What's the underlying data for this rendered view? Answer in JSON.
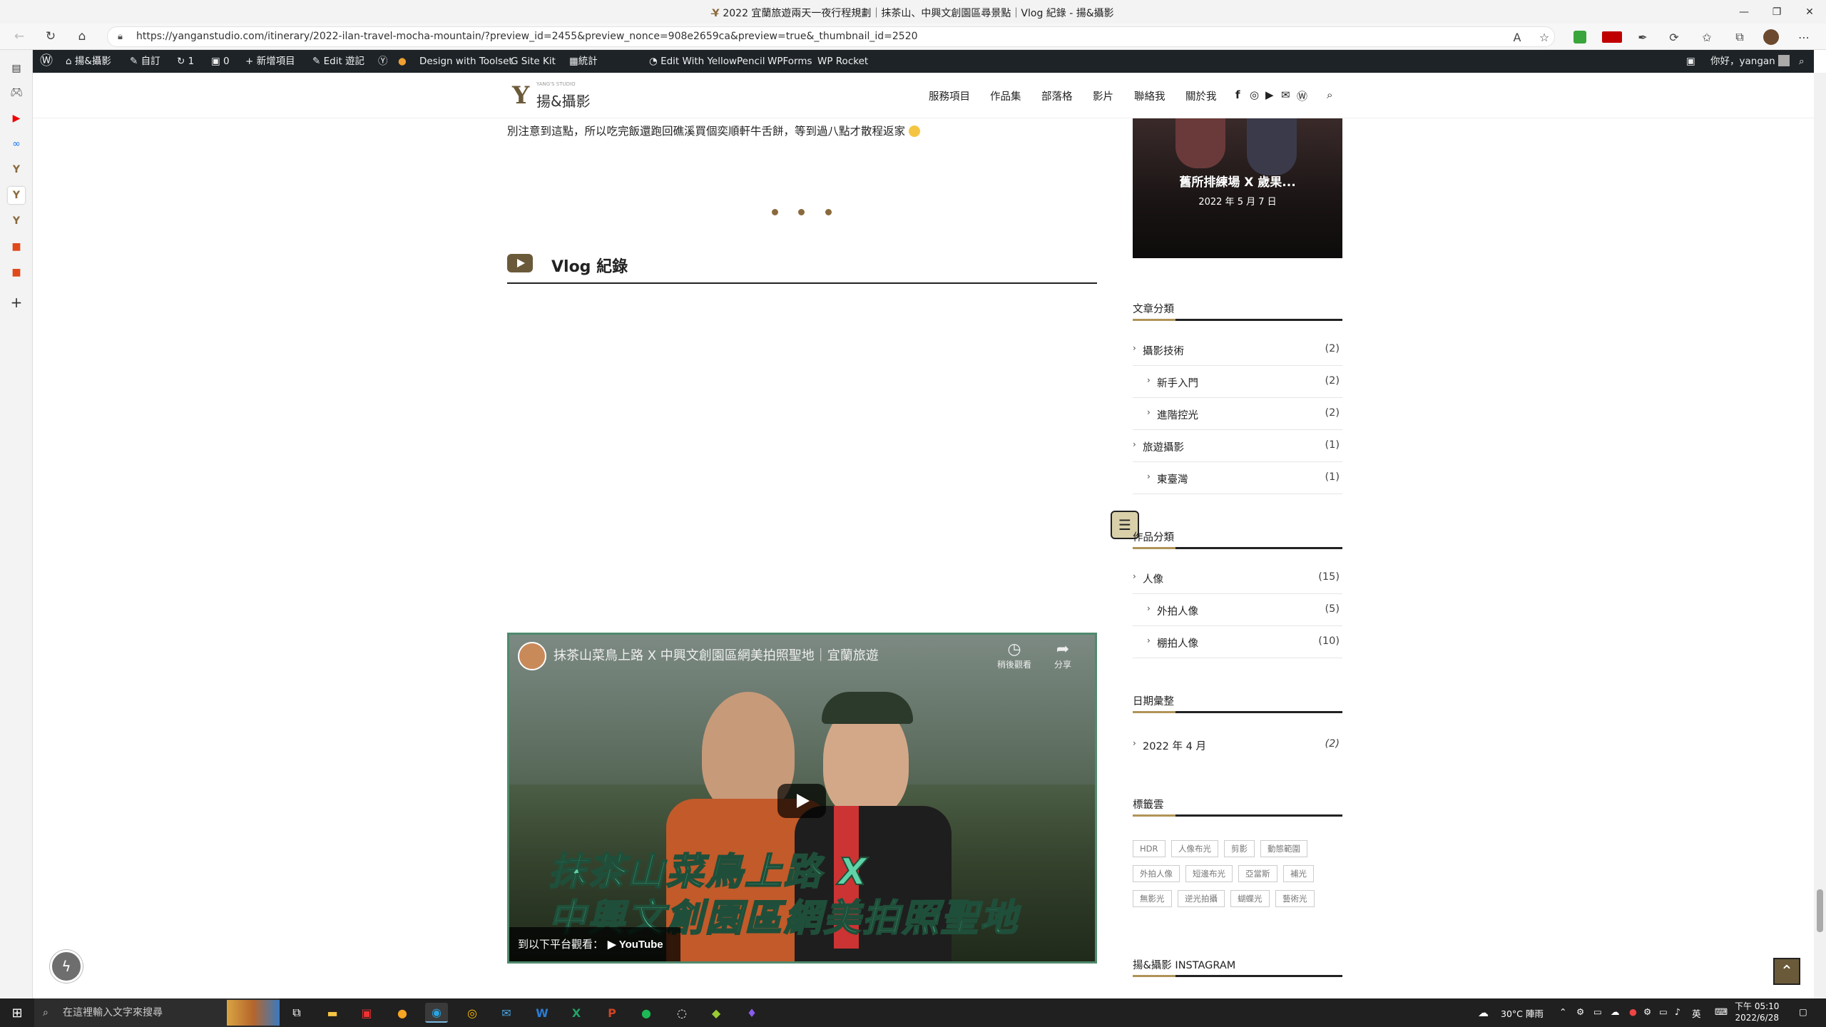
{
  "browser": {
    "tab_title": "2022 宜蘭旅遊兩天一夜行程規劃｜抹茶山、中興文創園區尋景點｜Vlog 紀錄 - 揚&攝影",
    "url": "https://yanganstudio.com/itinerary/2022-ilan-travel-mocha-mountain/?preview_id=2455&preview_nonce=908e2659ca&preview=true&_thumbnail_id=2520"
  },
  "wp_admin_bar": {
    "items": [
      {
        "label": "揚&攝影",
        "icon": "home-icon"
      },
      {
        "label": "自訂",
        "icon": "brush-icon"
      },
      {
        "label": "1",
        "icon": "refresh-icon"
      },
      {
        "label": "0",
        "icon": "comment-icon"
      },
      {
        "label": "新增項目",
        "icon": "plus-icon"
      },
      {
        "label": "Edit 遊記",
        "icon": "pencil-icon"
      },
      {
        "label": "Design with Toolset",
        "icon": "toolset-icon"
      },
      {
        "label": "Site Kit",
        "icon": "google-icon"
      },
      {
        "label": "統計",
        "icon": "stats-icon"
      },
      {
        "label": "Edit With YellowPencil",
        "icon": "yellowpencil-icon"
      },
      {
        "label": "WPForms",
        "icon": ""
      },
      {
        "label": "WP Rocket",
        "icon": ""
      }
    ],
    "greeting": "你好，yangan"
  },
  "site": {
    "logo_text": "揚&攝影",
    "logo_tagline": "YANG'S STUDIO",
    "menu": [
      "服務項目",
      "作品集",
      "部落格",
      "影片",
      "聯絡我",
      "關於我"
    ]
  },
  "article": {
    "text_line": "別注意到這點，所以吃完飯還跑回礁溪買個奕順軒牛舌餅，等到過八點才散程返家",
    "vlog_heading": "Vlog 紀錄",
    "video": {
      "title": "抹茶山菜鳥上路 X 中興文創園區網美拍照聖地｜宜蘭旅遊",
      "watch_later": "稍後觀看",
      "share": "分享",
      "overlay_line1": "抹茶山菜鳥上路 X",
      "overlay_line2": "中興文創園區網美拍照聖地",
      "watch_on": "到以下平台觀看：",
      "youtube": "YouTube"
    }
  },
  "sidebar": {
    "featured": {
      "title": "舊所排練場 X 歲果...",
      "date": "2022 年 5 月 7 日"
    },
    "article_categories": {
      "title": "文章分類",
      "items": [
        {
          "label": "攝影技術",
          "count": "(2)",
          "level": 0
        },
        {
          "label": "新手入門",
          "count": "(2)",
          "level": 1
        },
        {
          "label": "進階控光",
          "count": "(2)",
          "level": 1
        },
        {
          "label": "旅遊攝影",
          "count": "(1)",
          "level": 0
        },
        {
          "label": "東臺灣",
          "count": "(1)",
          "level": 1
        }
      ]
    },
    "work_categories": {
      "title": "作品分類",
      "items": [
        {
          "label": "人像",
          "count": "(15)",
          "level": 0
        },
        {
          "label": "外拍人像",
          "count": "(5)",
          "level": 1
        },
        {
          "label": "棚拍人像",
          "count": "(10)",
          "level": 1
        }
      ]
    },
    "archives": {
      "title": "日期彙整",
      "items": [
        {
          "label": "2022 年 4 月",
          "count": "(2)"
        }
      ]
    },
    "tags": {
      "title": "標籤雲",
      "items": [
        "HDR",
        "人像布光",
        "剪影",
        "動態範圍",
        "外拍人像",
        "短邊布光",
        "亞當斯",
        "補光",
        "無影光",
        "逆光拍攝",
        "蝴蝶光",
        "藝術光"
      ]
    },
    "instagram_title": "揚&攝影 INSTAGRAM"
  },
  "taskbar": {
    "search_placeholder": "在這裡輸入文字來搜尋",
    "weather": "30°C 陣雨",
    "ime": "英",
    "time": "下午 05:10",
    "date": "2022/6/28"
  }
}
